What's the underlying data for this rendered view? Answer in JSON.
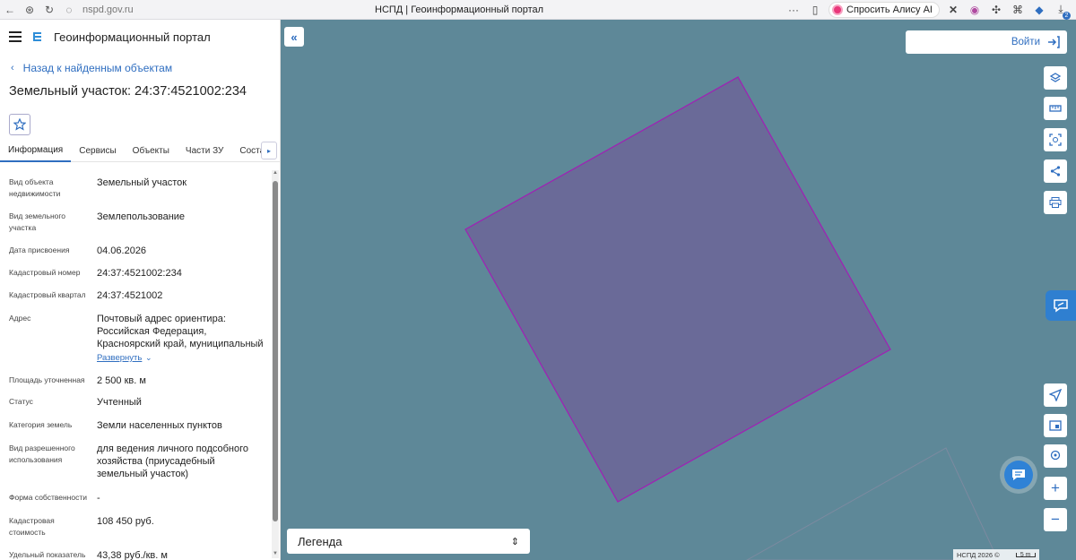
{
  "browser": {
    "url": "nspd.gov.ru",
    "tab_title": "НСПД | Геоинформационный портал",
    "more": "···",
    "alice_label": "Спросить Алису AI",
    "download_badge": "2"
  },
  "app": {
    "title": "Геоинформационный портал"
  },
  "back_link": "Назад к найденным объектам",
  "object_title": "Земельный участок: 24:37:4521002:234",
  "tabs": [
    "Информация",
    "Сервисы",
    "Объекты",
    "Части ЗУ",
    "Состав"
  ],
  "properties": [
    {
      "label": "Вид объекта недвижимости",
      "value": "Земельный участок"
    },
    {
      "label": "Вид земельного участка",
      "value": "Землепользование"
    },
    {
      "label": "Дата присвоения",
      "value": "04.06.2026"
    },
    {
      "label": "Кадастровый номер",
      "value": "24:37:4521002:234"
    },
    {
      "label": "Кадастровый квартал",
      "value": "24:37:4521002"
    },
    {
      "label": "Адрес",
      "value": "Почтовый адрес ориентира: Российская Федерация, Красноярский край, муниципальный"
    },
    {
      "label": "Площадь уточненная",
      "value": "2 500 кв. м"
    },
    {
      "label": "Статус",
      "value": "Учтенный"
    },
    {
      "label": "Категория земель",
      "value": "Земли населенных пунктов"
    },
    {
      "label": "Вид разрешенного использования",
      "value": "для ведения личного подсобного хозяйства (приусадебный земельный участок)"
    },
    {
      "label": "Форма собственности",
      "value": "-"
    },
    {
      "label": "Кадастровая стоимость",
      "value": "108 450 руб."
    },
    {
      "label": "Удельный показатель",
      "value": "43,38 руб./кв. м"
    }
  ],
  "expand_label": "Развернуть",
  "map": {
    "login_label": "Войти",
    "legend_label": "Легенда",
    "credits": "НСПД 2026 ©",
    "scale_label": "5 m",
    "colors": {
      "background": "#5e8898",
      "parcel_fill": "#6a6a98",
      "parcel_stroke": "#a11fb5",
      "accent": "#2f6ec0"
    }
  }
}
